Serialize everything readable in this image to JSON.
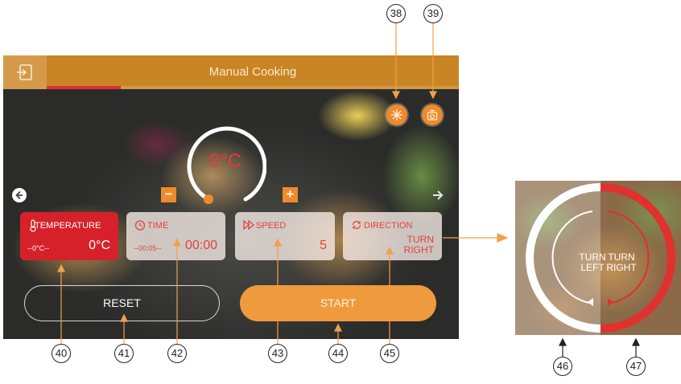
{
  "header": {
    "title": "Manual Cooking",
    "progress_fraction": 0.18
  },
  "dial": {
    "value": "0°C"
  },
  "cards": {
    "temperature": {
      "label": "TEMPERATURE",
      "range": "--0°C--",
      "value": "0°C"
    },
    "time": {
      "label": "TIME",
      "range": "--00:05--",
      "value": "00:00"
    },
    "speed": {
      "label": "SPEED",
      "value": "5"
    },
    "direction": {
      "label": "DIRECTION",
      "value_line1": "TURN",
      "value_line2": "RIGHT"
    }
  },
  "buttons": {
    "reset": "RESET",
    "start": "START",
    "minus": "−",
    "plus": "+"
  },
  "inset": {
    "left_line1": "TURN",
    "left_line2": "LEFT",
    "right_line1": "TURN",
    "right_line2": "RIGHT"
  },
  "callouts": {
    "c38": "38",
    "c39": "39",
    "c40": "40",
    "c41": "41",
    "c42": "42",
    "c43": "43",
    "c44": "44",
    "c45": "45",
    "c46": "46",
    "c47": "47"
  },
  "colors": {
    "titlebar": "#c98524",
    "accent_orange": "#ef8a2a",
    "accent_red": "#e0312e",
    "temperature_card": "#d7212a",
    "start_button": "#f09a3e",
    "leader_line": "#f0a04b"
  },
  "icons": {
    "back": "exit-icon",
    "steam": "snowflake-icon",
    "scale": "weighing-scale-icon",
    "temperature": "thermometer-icon",
    "time": "stopwatch-icon",
    "speed": "fast-forward-icon",
    "direction": "rotate-icon"
  }
}
